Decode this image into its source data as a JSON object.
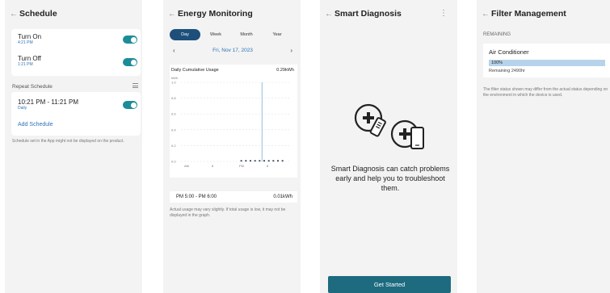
{
  "schedule": {
    "title": "Schedule",
    "turn_on": {
      "label": "Turn On",
      "time": "4:21 PM"
    },
    "turn_off": {
      "label": "Turn Off",
      "time": "1:21 PM"
    },
    "repeat_label": "Repeat Schedule",
    "repeat_item": {
      "range": "10:21 PM - 11:21 PM",
      "freq": "Daily"
    },
    "add_label": "Add Schedule",
    "note": "Schedule set in the App might not be displayed on the product."
  },
  "energy": {
    "title": "Energy Monitoring",
    "tabs": [
      "Day",
      "Week",
      "Month",
      "Year"
    ],
    "date": "Fri, Nov 17, 2023",
    "chart_title": "Daily Cumulative Usage",
    "chart_total": "0.29kWh",
    "usage_range": "PM 5:00 - PM 6:00",
    "usage_value": "0.01kWh",
    "note": "Actual usage may vary slightly. If total usage is low, it may not be displayed in the graph."
  },
  "chart_data": {
    "type": "bar",
    "title": "Daily Cumulative Usage",
    "ylabel": "kWh",
    "ylim": [
      0,
      1
    ],
    "y_ticks": [
      "1.0",
      "0.8",
      "0.6",
      "0.4",
      "0.2",
      "0.0"
    ],
    "x_ticks": [
      "AM",
      "6",
      "PM",
      "6"
    ],
    "x": [
      13,
      14,
      15,
      16,
      17,
      18,
      19,
      20,
      21,
      22
    ],
    "values": [
      0.01,
      0.01,
      0.01,
      0.01,
      0.01,
      0.01,
      0.01,
      0.01,
      0.01,
      0.01
    ],
    "highlight_x": 17,
    "colors": {
      "bar": "#1e2a3a",
      "highlight": "#8fc0e6",
      "grid": "#e3e3e3"
    },
    "grid": true
  },
  "diagnosis": {
    "title": "Smart Diagnosis",
    "description": "Smart Diagnosis can catch problems early and help you to troubleshoot them.",
    "button": "Get Started"
  },
  "filter": {
    "title": "Filter Management",
    "remaining_label": "REMAINING",
    "item": "Air Conditioner",
    "percent": "100%",
    "percent_value": 1.0,
    "remaining_hours": "Remaining 2490hr",
    "note": "The filter status shown may differ from the actual status depending on the environment in which the device is used."
  },
  "colors": {
    "accent": "#1d8c99",
    "link": "#2a73b8",
    "button": "#1e6b80"
  }
}
